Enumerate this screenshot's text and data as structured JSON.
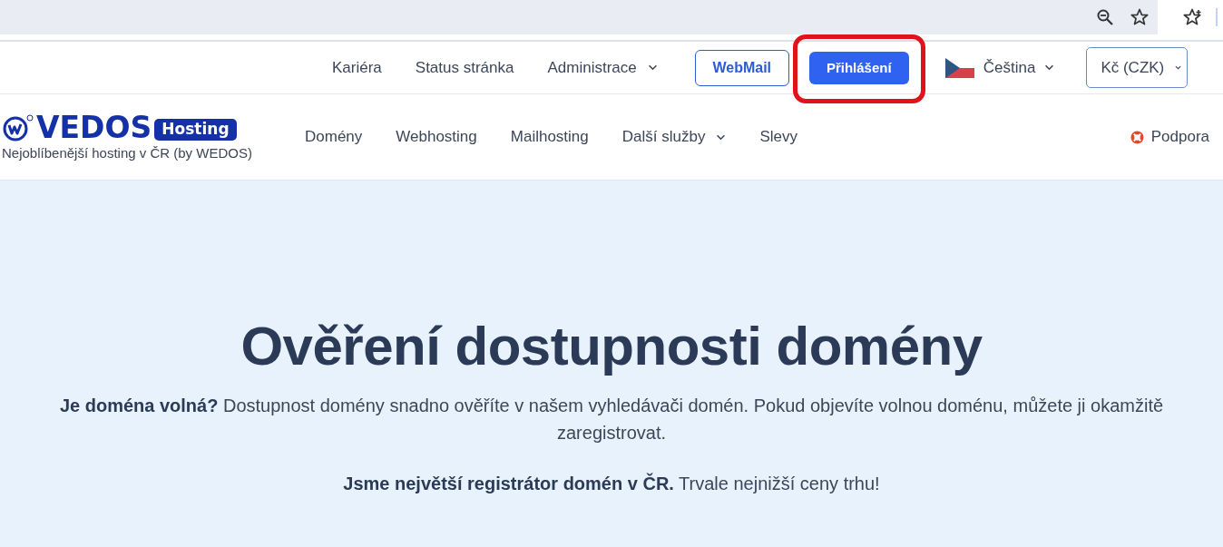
{
  "top_nav": {
    "links": [
      {
        "label": "Kariéra",
        "has_menu": false
      },
      {
        "label": "Status stránka",
        "has_menu": false
      },
      {
        "label": "Administrace",
        "has_menu": true
      }
    ],
    "webmail": "WebMail",
    "login": {
      "label": "Přihlášení",
      "highlighted": true
    },
    "language": "Čeština",
    "currency": "Kč (CZK)"
  },
  "main_nav": {
    "logo": {
      "brand": "VEDOS",
      "badge": "Hosting",
      "tagline": "Nejoblíbenější hosting v ČR (by WEDOS)"
    },
    "items": [
      {
        "label": "Domény",
        "has_menu": false
      },
      {
        "label": "Webhosting",
        "has_menu": false
      },
      {
        "label": "Mailhosting",
        "has_menu": false
      },
      {
        "label": "Další služby",
        "has_menu": true
      },
      {
        "label": "Slevy",
        "has_menu": false
      }
    ],
    "support": "Podpora"
  },
  "hero": {
    "title": "Ověření dostupnosti domény",
    "paragraphs": [
      "**Je doména volná?** Dostupnost domény snadno ověříte v našem vyhledávači domén. Pokud objevíte volnou doménu, můžete ji okamžitě zaregistrovat.",
      "**Jsme největší registrátor domén v ČR.** Trvale nejnižší ceny trhu!"
    ]
  }
}
